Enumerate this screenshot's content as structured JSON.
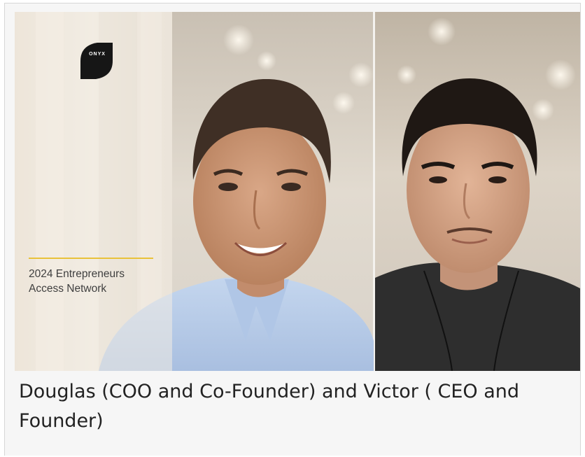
{
  "photo": {
    "alt": "Douglas and Victor",
    "logo_text": "ONYX",
    "overlay_line1": "2024 Entrepreneurs",
    "overlay_line2": "Access Network",
    "colors": {
      "accent_line": "#e9c23a",
      "logo_bg": "#161616",
      "shirt_blue": "#b8cde9",
      "tshirt_dark": "#2e2e2e"
    }
  },
  "caption": "Douglas (COO and Co-Founder) and Victor ( CEO and Founder)"
}
